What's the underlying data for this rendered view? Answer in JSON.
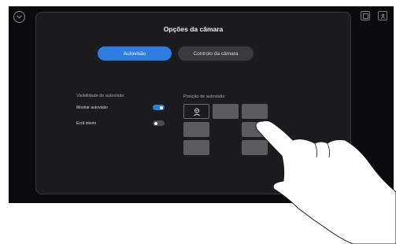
{
  "modal": {
    "title": "Opções da câmara",
    "tabs": [
      {
        "label": "Autovisão",
        "active": true
      },
      {
        "label": "Controlo da câmara",
        "active": false
      }
    ]
  },
  "settings": {
    "section_label": "Visibilidade de autovisão",
    "items": [
      {
        "label": "Mostrar autovisão",
        "enabled": true
      },
      {
        "label": "Ecrã inteiro",
        "enabled": false
      }
    ]
  },
  "position": {
    "section_label": "Posição de autovisão",
    "selected_cell": "top-left",
    "cells": [
      "selected",
      "tile",
      "tile",
      "tile",
      "empty",
      "tile",
      "tile",
      "empty",
      "tile"
    ]
  },
  "colors": {
    "accent": "#2f7de0",
    "background": "#0b0b0d",
    "modal": "#1c1c1f",
    "tile": "#5b5b60"
  },
  "icons": {
    "top_left": "chevron-down-icon",
    "top_right": [
      "layout-icon",
      "self-view-icon"
    ],
    "selected_tile": "person-icon"
  }
}
